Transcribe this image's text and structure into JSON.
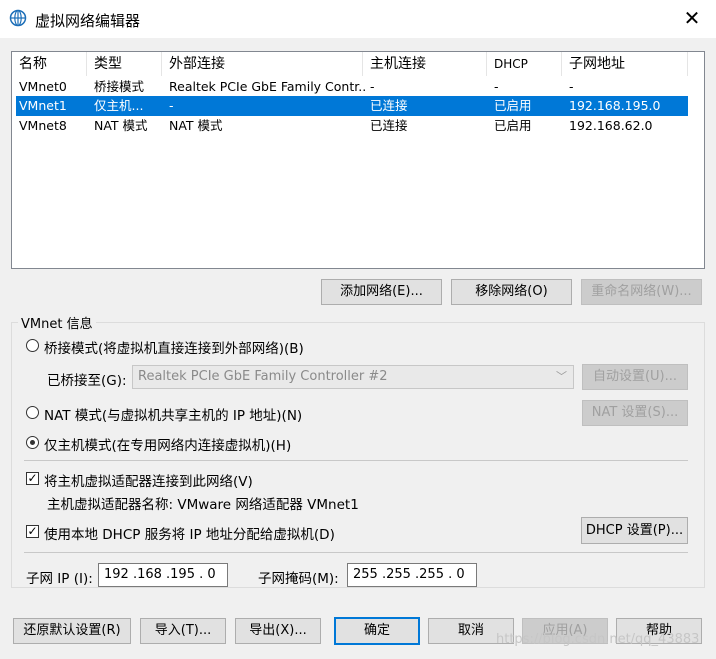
{
  "window": {
    "title": "虚拟网络编辑器",
    "close_glyph": "✕"
  },
  "list": {
    "columns": [
      "名称",
      "类型",
      "外部连接",
      "主机连接",
      "DHCP",
      "子网地址"
    ],
    "rows": [
      [
        "VMnet0",
        "桥接模式",
        "Realtek PCIe GbE Family Contr...",
        "-",
        "-",
        "-"
      ],
      [
        "VMnet1",
        "仅主机...",
        "-",
        "已连接",
        "已启用",
        "192.168.195.0"
      ],
      [
        "VMnet8",
        "NAT 模式",
        "NAT 模式",
        "已连接",
        "已启用",
        "192.168.62.0"
      ]
    ],
    "selected_row": 1
  },
  "list_buttons": {
    "add": "添加网络(E)...",
    "remove": "移除网络(O)",
    "rename": "重命名网络(W)..."
  },
  "vmnet_info": {
    "legend": "VMnet 信息",
    "bridged_radio": "桥接模式(将虚拟机直接连接到外部网络)(B)",
    "bridged_to_label": "已桥接至(G):",
    "bridged_to_value": "Realtek PCIe GbE Family Controller #2",
    "auto_settings": "自动设置(U)...",
    "nat_radio": "NAT 模式(与虚拟机共享主机的 IP 地址)(N)",
    "nat_settings": "NAT 设置(S)...",
    "hostonly_radio": "仅主机模式(在专用网络内连接虚拟机)(H)",
    "selected_mode": "hostonly",
    "connect_adapter_check": "将主机虚拟适配器连接到此网络(V)",
    "adapter_name": "主机虚拟适配器名称: VMware 网络适配器 VMnet1",
    "dhcp_check": "使用本地 DHCP 服务将 IP 地址分配给虚拟机(D)",
    "dhcp_settings": "DHCP 设置(P)...",
    "subnet_ip_label": "子网 IP (I):",
    "subnet_ip_value": "192 .168 .195 . 0",
    "subnet_mask_label": "子网掩码(M):",
    "subnet_mask_value": "255 .255 .255 . 0"
  },
  "bottom_buttons": {
    "restore": "还原默认设置(R)",
    "import": "导入(T)...",
    "export": "导出(X)...",
    "ok": "确定",
    "cancel": "取消",
    "apply": "应用(A)",
    "help": "帮助"
  },
  "watermark": "https://blog.csdn.net/qq_43883"
}
